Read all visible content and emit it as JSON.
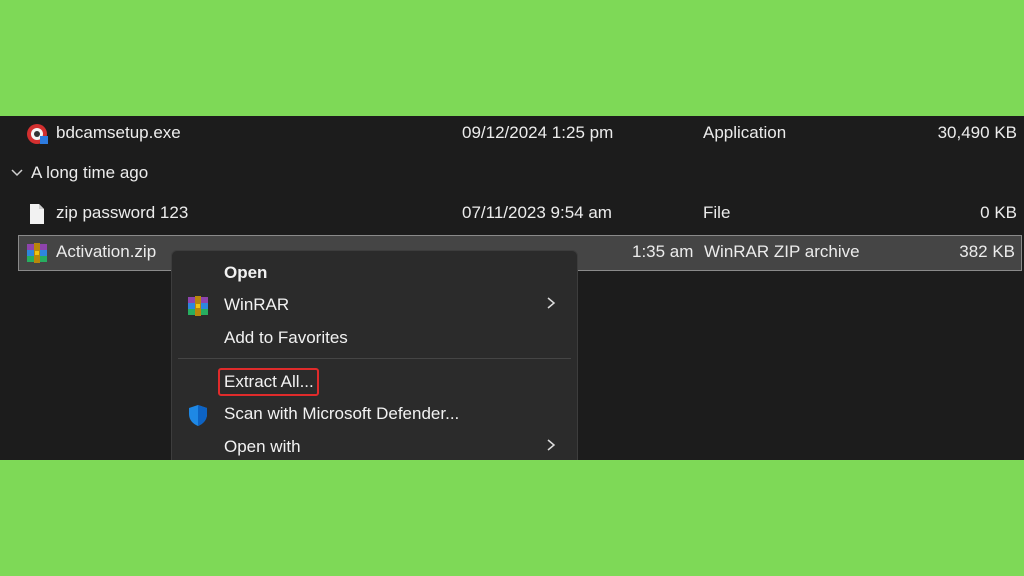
{
  "files": {
    "top_row": {
      "name": "bdcamsetup.exe",
      "date": "09/12/2024 1:25 pm",
      "type": "Application",
      "size": "30,490 KB",
      "icon": "bdcam-app-icon"
    },
    "group_header": "A long time ago",
    "row2": {
      "name": "zip password 123",
      "date": "07/11/2023 9:54 am",
      "type": "File",
      "size": "0 KB",
      "icon": "blank-file-icon"
    },
    "selected_row": {
      "name": "Activation.zip",
      "date_partial": "1:35 am",
      "type": "WinRAR ZIP archive",
      "size": "382 KB",
      "icon": "winrar-archive-icon"
    }
  },
  "context_menu": {
    "open": "Open",
    "winrar": "WinRAR",
    "add_to_favorites": "Add to Favorites",
    "extract_all": "Extract All...",
    "scan_defender": "Scan with Microsoft Defender...",
    "open_with": "Open with"
  },
  "colors": {
    "page_background": "#7ed957",
    "explorer_background": "#1c1c1c",
    "selection": "#454545",
    "menu_background": "#2b2b2b",
    "highlight_outline": "#e02b2b"
  }
}
